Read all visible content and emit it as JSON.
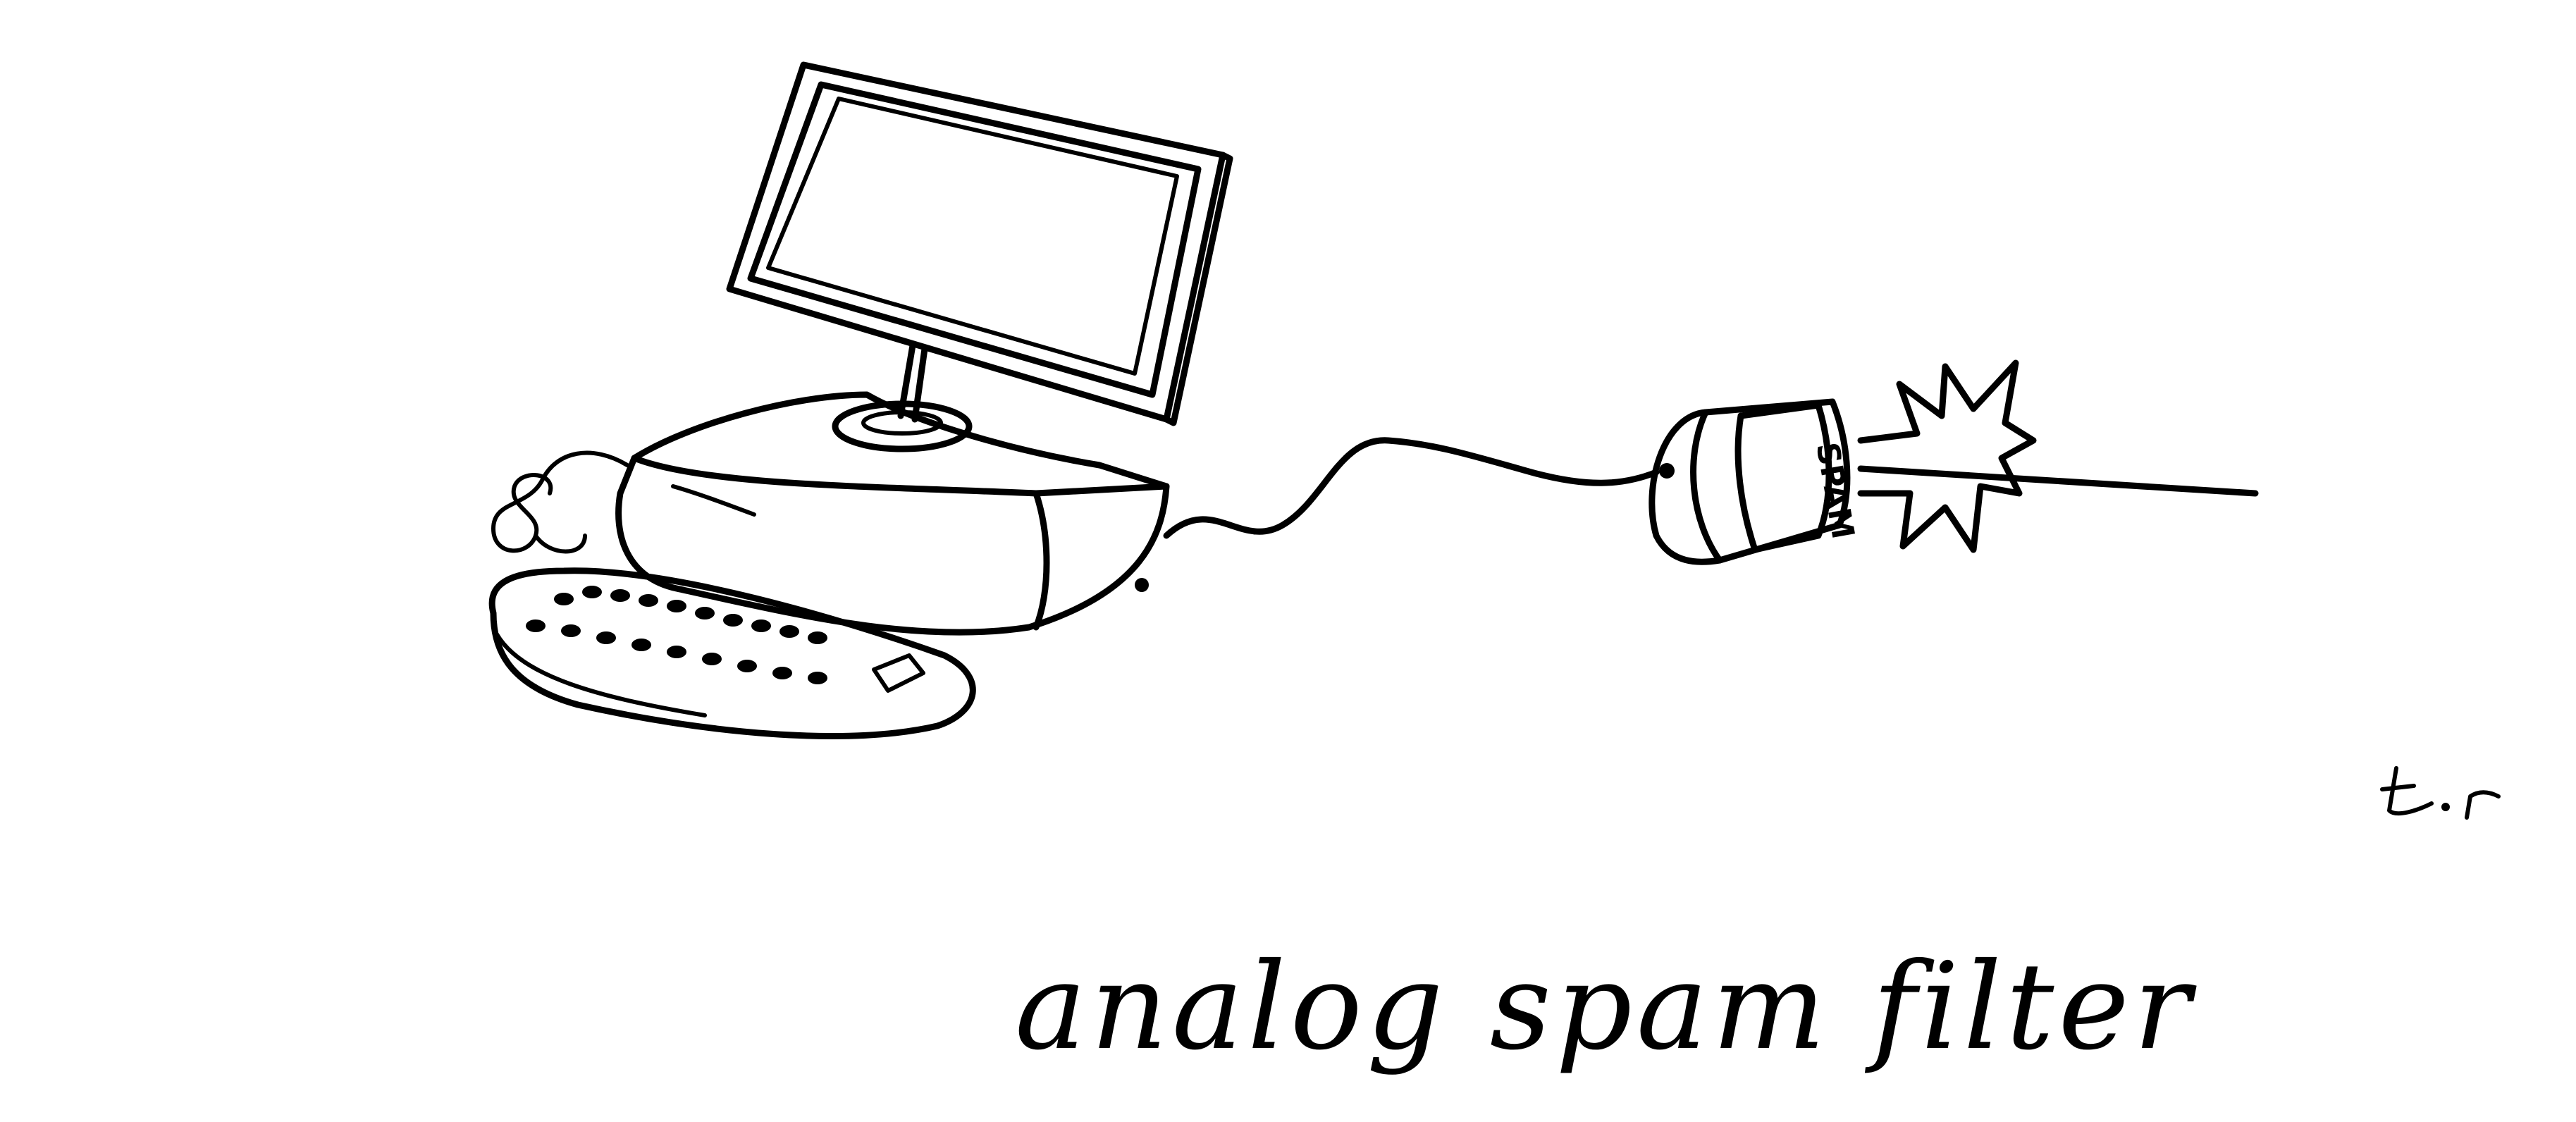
{
  "cartoon": {
    "caption": "analog spam filter",
    "can_label": "SPAM",
    "signature": "t.r"
  },
  "icons": {
    "monitor": "computer-monitor-icon",
    "base": "computer-base-icon",
    "keyboard": "keyboard-icon",
    "cable": "power-cable-icon",
    "can": "spam-can-icon",
    "explosion": "explosion-icon"
  }
}
